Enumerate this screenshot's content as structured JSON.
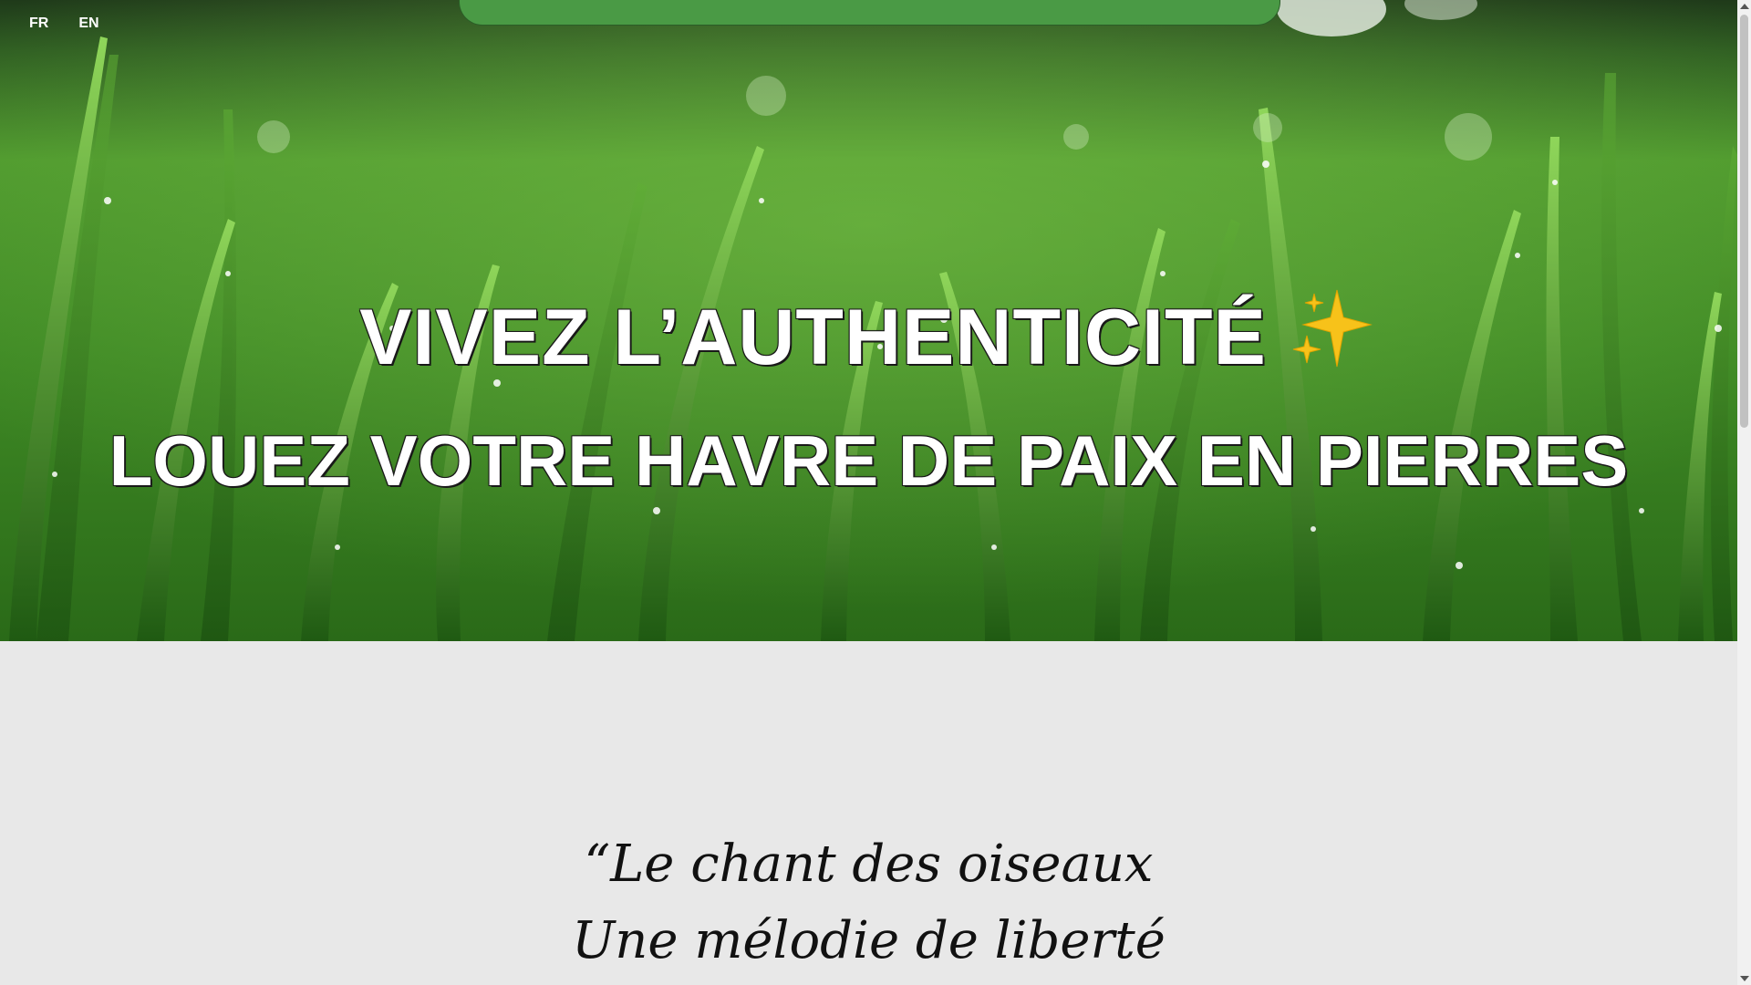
{
  "language_switch": {
    "items": [
      {
        "label": "FR"
      },
      {
        "label": "EN"
      }
    ]
  },
  "hero": {
    "headline_line1": "VIVEZ L’AUTHENTICITÉ",
    "headline_emoji": "sparkles-icon",
    "headline_line2": "LOUEZ VOTRE HAVRE DE PAIX EN PIERRES",
    "background": "grass-with-dew-drops",
    "accent_color": "#4a9a45"
  },
  "quote": {
    "line1": "“Le chant des oiseaux",
    "line2": "Une mélodie de liberté"
  },
  "colors": {
    "page_background": "#e8e8e8",
    "top_tab": "#4a9a45",
    "headline_text": "#ffffff",
    "quote_text": "#111111"
  }
}
